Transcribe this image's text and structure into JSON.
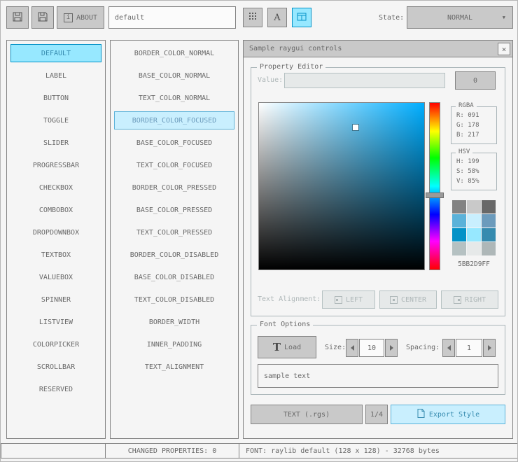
{
  "colors": {
    "bg": "#f5f5f5",
    "border": "#838383",
    "base": "#c9c9c9",
    "text": "#686868",
    "selected_border": "#0492c7",
    "selected_base": "#97e8ff",
    "selected_text": "#368baf",
    "focused_border": "#5bb2d9",
    "focused_base": "#c9effe",
    "focused_text": "#6c9bbc",
    "disabled_border": "#b5c1c2",
    "disabled_base": "#e6e9e9",
    "disabled_text": "#aeb7b8",
    "picker_hue": "#00aeff"
  },
  "icons": {
    "about_info": "i",
    "font_button": "A",
    "dropdown_arrow": "▼",
    "close": "×",
    "load_t": "T"
  },
  "toolbar": {
    "about_label": "ABOUT",
    "style_name_value": "default",
    "state_label": "State:",
    "state_value": "NORMAL"
  },
  "controls_list": {
    "selected": "DEFAULT",
    "items": [
      "DEFAULT",
      "LABEL",
      "BUTTON",
      "TOGGLE",
      "SLIDER",
      "PROGRESSBAR",
      "CHECKBOX",
      "COMBOBOX",
      "DROPDOWNBOX",
      "TEXTBOX",
      "VALUEBOX",
      "SPINNER",
      "LISTVIEW",
      "COLORPICKER",
      "SCROLLBAR",
      "RESERVED"
    ]
  },
  "properties_list": {
    "selected": "BORDER_COLOR_FOCUSED",
    "items": [
      "BORDER_COLOR_NORMAL",
      "BASE_COLOR_NORMAL",
      "TEXT_COLOR_NORMAL",
      "BORDER_COLOR_FOCUSED",
      "BASE_COLOR_FOCUSED",
      "TEXT_COLOR_FOCUSED",
      "BORDER_COLOR_PRESSED",
      "BASE_COLOR_PRESSED",
      "TEXT_COLOR_PRESSED",
      "BORDER_COLOR_DISABLED",
      "BASE_COLOR_DISABLED",
      "TEXT_COLOR_DISABLED",
      "BORDER_WIDTH",
      "INNER_PADDING",
      "TEXT_ALIGNMENT"
    ]
  },
  "sample_window": {
    "title": "Sample raygui controls",
    "property_editor": {
      "group_label": "Property Editor",
      "value_label": "Value:",
      "value_text": "",
      "value_button": "0",
      "rgba": {
        "label": "RGBA",
        "r": "R: 091",
        "g": "G: 178",
        "b": "B: 217"
      },
      "hsv": {
        "label": "HSV",
        "h": "H: 199",
        "s": "S: 58%",
        "v": "V: 85%"
      },
      "hex": "5BB2D9FF",
      "color_grid": [
        "#838383",
        "#c9c9c9",
        "#686868",
        "#5bb2d9",
        "#c9effe",
        "#6c9bbc",
        "#0492c7",
        "#97e8ff",
        "#368baf",
        "#b5c1c2",
        "#e6e9e9",
        "#aeb7b8"
      ],
      "text_alignment_label": "Text Alignment:",
      "align_left": "LEFT",
      "align_center": "CENTER",
      "align_right": "RIGHT"
    },
    "font_options": {
      "group_label": "Font Options",
      "load_label": "Load",
      "size_label": "Size:",
      "size_value": "10",
      "spacing_label": "Spacing:",
      "spacing_value": "1",
      "sample_text": "sample text"
    },
    "export": {
      "text_rgs": "TEXT (.rgs)",
      "pager": "1/4",
      "export_style": "Export Style"
    }
  },
  "status_bar": {
    "left": "",
    "changed": "CHANGED PROPERTIES: 0",
    "font_info": "FONT: raylib default (128 x 128) - 32768 bytes"
  }
}
